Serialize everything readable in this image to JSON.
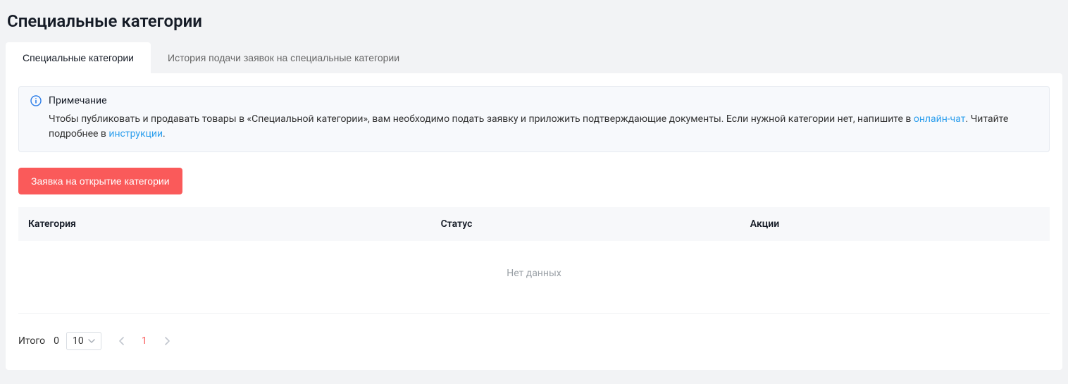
{
  "header": {
    "title": "Специальные категории"
  },
  "tabs": [
    {
      "label": "Специальные категории",
      "active": true
    },
    {
      "label": "История подачи заявок на специальные категории",
      "active": false
    }
  ],
  "notice": {
    "title": "Примечание",
    "body_part1": "Чтобы публиковать и продавать товары в «Специальной категории», вам необходимо подать заявку и приложить подтверждающие документы. Если нужной категории нет, напишите в ",
    "link1_label": "онлайн-чат",
    "body_part2": ". Читайте подробнее в ",
    "link2_label": "инструкции",
    "body_part3": "."
  },
  "actions": {
    "open_category_button": "Заявка на открытие категории"
  },
  "table": {
    "columns": {
      "category": "Категория",
      "status": "Статус",
      "actions": "Акции"
    },
    "empty_text": "Нет данных"
  },
  "pagination": {
    "total_label": "Итого",
    "total_value": "0",
    "page_size": "10",
    "current_page": "1"
  }
}
